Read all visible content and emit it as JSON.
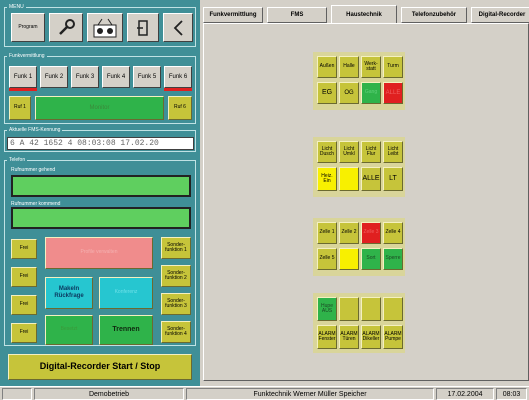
{
  "menu": {
    "title": "MENU",
    "program_label": "Program"
  },
  "funkvermittlung": {
    "title": "Funkvermittlung",
    "channels": [
      "Funk 1",
      "Funk 2",
      "Funk 3",
      "Funk 4",
      "Funk 5",
      "Funk 6"
    ],
    "ruf1": "Ruf 1",
    "monitor": "Monitor",
    "ruf6": "Ruf 6"
  },
  "fms": {
    "title": "Aktuelle FMS-Kennung",
    "value": "6 A 42 1652 4  08:03:08  17.02.20"
  },
  "telefon": {
    "title": "Telefon",
    "incoming_label": "Rufnummer gehend",
    "outgoing_label": "Rufnummer kommend",
    "frei": [
      "Frei",
      "Frei",
      "Frei",
      "Frei"
    ],
    "pflegen": "Profile verwalten",
    "makeln": "Makeln Rückfrage",
    "konferenz": "Konferenz",
    "besetzt": "Besetzt",
    "trennen": "Trennen",
    "sonder": [
      "Sonder-funktion 1",
      "Sonder-funktion 2",
      "Sonder-funktion 3",
      "Sonder-funktion 4"
    ]
  },
  "recorder_button": "Digital-Recorder Start / Stop",
  "tabs": [
    "Funkvermittlung",
    "FMS",
    "Haustechnik",
    "Telefonzubehör",
    "Digital-Recorder"
  ],
  "haustechnik": {
    "g1r1": [
      "Außen",
      "Halle",
      "Werk-statt",
      "Turm"
    ],
    "g1r2": [
      "EG",
      "OG",
      "Gang",
      "ALLE"
    ],
    "g2r1": [
      "Licht Dusch",
      "Licht Umkl",
      "Licht Flur",
      "Licht Leibt"
    ],
    "g2r2": [
      "Heiz. Ein",
      "",
      "ALLE",
      "LT"
    ],
    "g3r1": [
      "Zelle 1",
      "Zelle 2",
      "Zelle 3",
      "Zelle 4"
    ],
    "g3r2": [
      "Zelle 5",
      "",
      "Sort",
      "Sperre"
    ],
    "g4r1": [
      "Hupe AUS",
      "",
      "",
      ""
    ],
    "g4r2": [
      "ALARM Fenster",
      "ALARM Türen",
      "ALARM Dikeller",
      "ALARM Pumpe"
    ]
  },
  "statusbar": {
    "mode": "Demobetrieb",
    "company": "Funktechnik Werner Müller Speicher",
    "date": "17.02.2004",
    "time": "08:03"
  },
  "colors": {
    "panel": "#3f8f97",
    "olive": "#c6c43a",
    "yellow": "#f8f000",
    "green": "#2fb34a",
    "red": "#e02020",
    "pink": "#f08c8c",
    "cyan": "#26c6d0"
  },
  "icons": [
    "wrench-icon",
    "radio-icon",
    "exit-icon",
    "back-arrow-icon"
  ]
}
